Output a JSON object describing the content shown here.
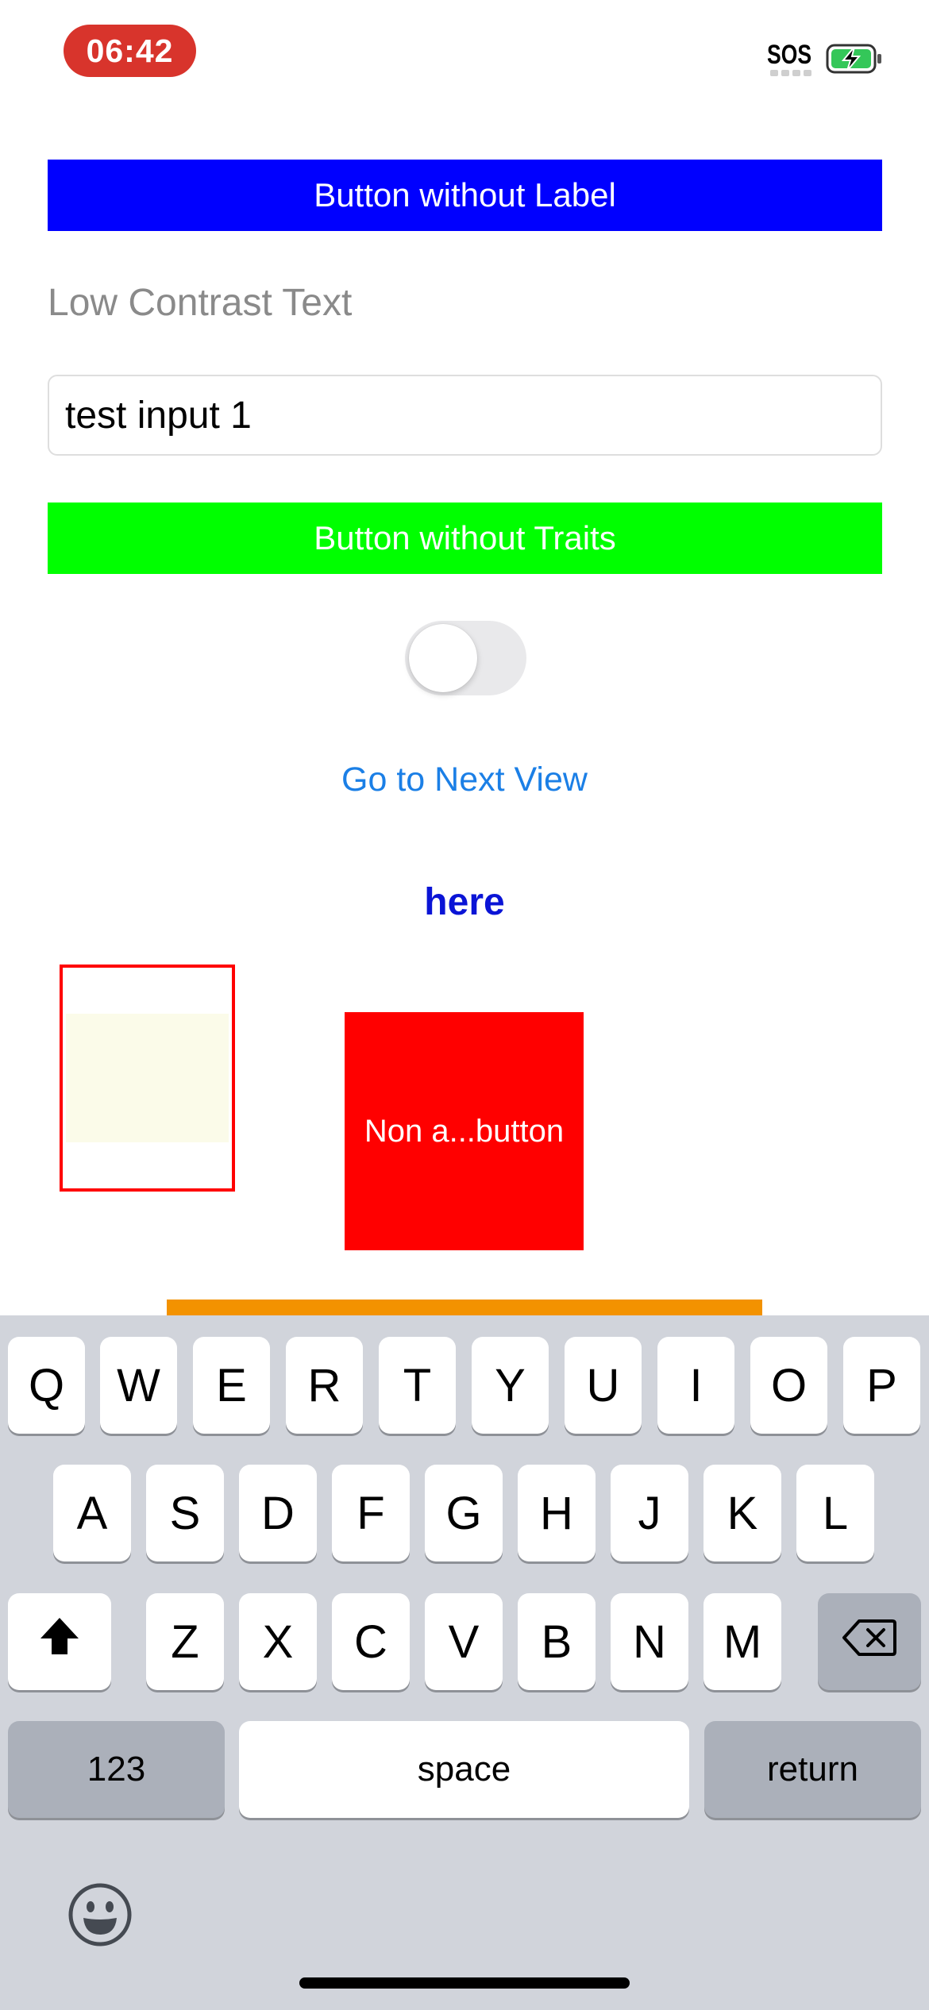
{
  "status_bar": {
    "time": "06:42",
    "sos": "SOS",
    "battery_icon": "battery-charging-icon"
  },
  "main": {
    "button_without_label": "Button without Label",
    "low_contrast_text": "Low Contrast Text",
    "input_value": "test input 1",
    "button_without_traits": "Button without Traits",
    "toggle_state": "off",
    "next_view_link": "Go to Next View",
    "here_link": "here",
    "red_box_label": "Non a...button"
  },
  "colors": {
    "blue_button": "#0000ff",
    "green_button": "#00ff00",
    "red_box": "#ff0000",
    "orange_bar": "#f39200",
    "link_blue": "#1b7fe6",
    "time_pill": "#d8342c"
  },
  "keyboard": {
    "row1": [
      "Q",
      "W",
      "E",
      "R",
      "T",
      "Y",
      "U",
      "I",
      "O",
      "P"
    ],
    "row2": [
      "A",
      "S",
      "D",
      "F",
      "G",
      "H",
      "J",
      "K",
      "L"
    ],
    "row3": [
      "Z",
      "X",
      "C",
      "V",
      "B",
      "N",
      "M"
    ],
    "numbers_key": "123",
    "space_key": "space",
    "return_key": "return",
    "shift_icon": "shift-icon",
    "delete_icon": "delete-icon",
    "emoji_icon": "emoji-icon"
  }
}
